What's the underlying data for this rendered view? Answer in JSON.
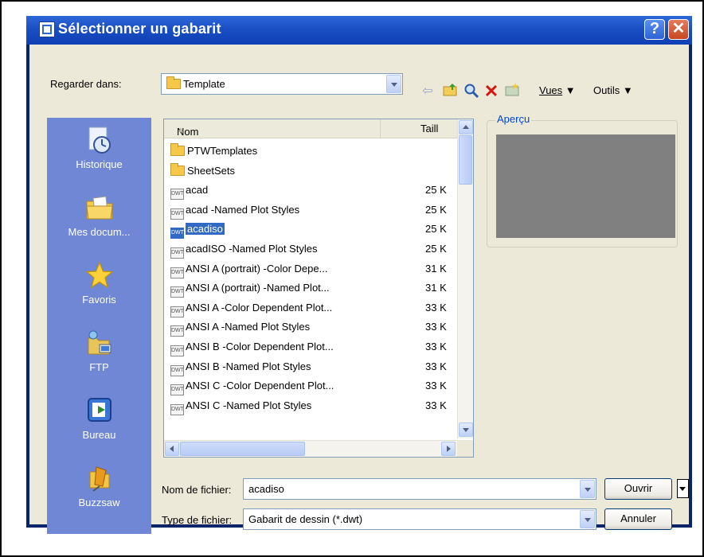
{
  "dialog": {
    "title": "Sélectionner un gabarit",
    "help_glyph": "?",
    "close_glyph": "✕"
  },
  "lookin": {
    "label": "Regarder dans:",
    "value": "Template"
  },
  "toolbar": {
    "vues_label": "Vues",
    "outils_label": "Outils"
  },
  "places": [
    {
      "label": "Historique",
      "icon": "history-icon"
    },
    {
      "label": "Mes docum...",
      "icon": "my-documents-icon"
    },
    {
      "label": "Favoris",
      "icon": "favorites-star-icon"
    },
    {
      "label": "FTP",
      "icon": "ftp-icon"
    },
    {
      "label": "Bureau",
      "icon": "desktop-icon"
    },
    {
      "label": "Buzzsaw",
      "icon": "buzzsaw-icon"
    }
  ],
  "filelist": {
    "col_name": "Nom",
    "col_size": "Taill",
    "rows": [
      {
        "name": "PTWTemplates",
        "size": "",
        "type": "folder"
      },
      {
        "name": "SheetSets",
        "size": "",
        "type": "folder"
      },
      {
        "name": "acad",
        "size": "25 K",
        "type": "dwt"
      },
      {
        "name": "acad -Named Plot Styles",
        "size": "25 K",
        "type": "dwt"
      },
      {
        "name": "acadiso",
        "size": "25 K",
        "type": "dwt",
        "selected": true
      },
      {
        "name": "acadISO -Named Plot Styles",
        "size": "25 K",
        "type": "dwt"
      },
      {
        "name": "ANSI A (portrait) -Color Depe...",
        "size": "31 K",
        "type": "dwt"
      },
      {
        "name": "ANSI A (portrait) -Named Plot...",
        "size": "31 K",
        "type": "dwt"
      },
      {
        "name": "ANSI A -Color Dependent Plot...",
        "size": "33 K",
        "type": "dwt"
      },
      {
        "name": "ANSI A -Named Plot Styles",
        "size": "33 K",
        "type": "dwt"
      },
      {
        "name": "ANSI B -Color Dependent Plot...",
        "size": "33 K",
        "type": "dwt"
      },
      {
        "name": "ANSI B -Named Plot Styles",
        "size": "33 K",
        "type": "dwt"
      },
      {
        "name": "ANSI C -Color Dependent Plot...",
        "size": "33 K",
        "type": "dwt"
      },
      {
        "name": "ANSI C -Named Plot Styles",
        "size": "33 K",
        "type": "dwt"
      }
    ]
  },
  "preview": {
    "label": "Aperçu"
  },
  "filename": {
    "label": "Nom de fichier:",
    "value": "acadiso"
  },
  "filetype": {
    "label": "Type de fichier:",
    "value": "Gabarit de dessin (*.dwt)"
  },
  "buttons": {
    "open": "Ouvrir",
    "cancel": "Annuler"
  },
  "colors": {
    "selection": "#316ac5",
    "places_bar": "#6f87d4",
    "preview_bg": "#808080"
  }
}
